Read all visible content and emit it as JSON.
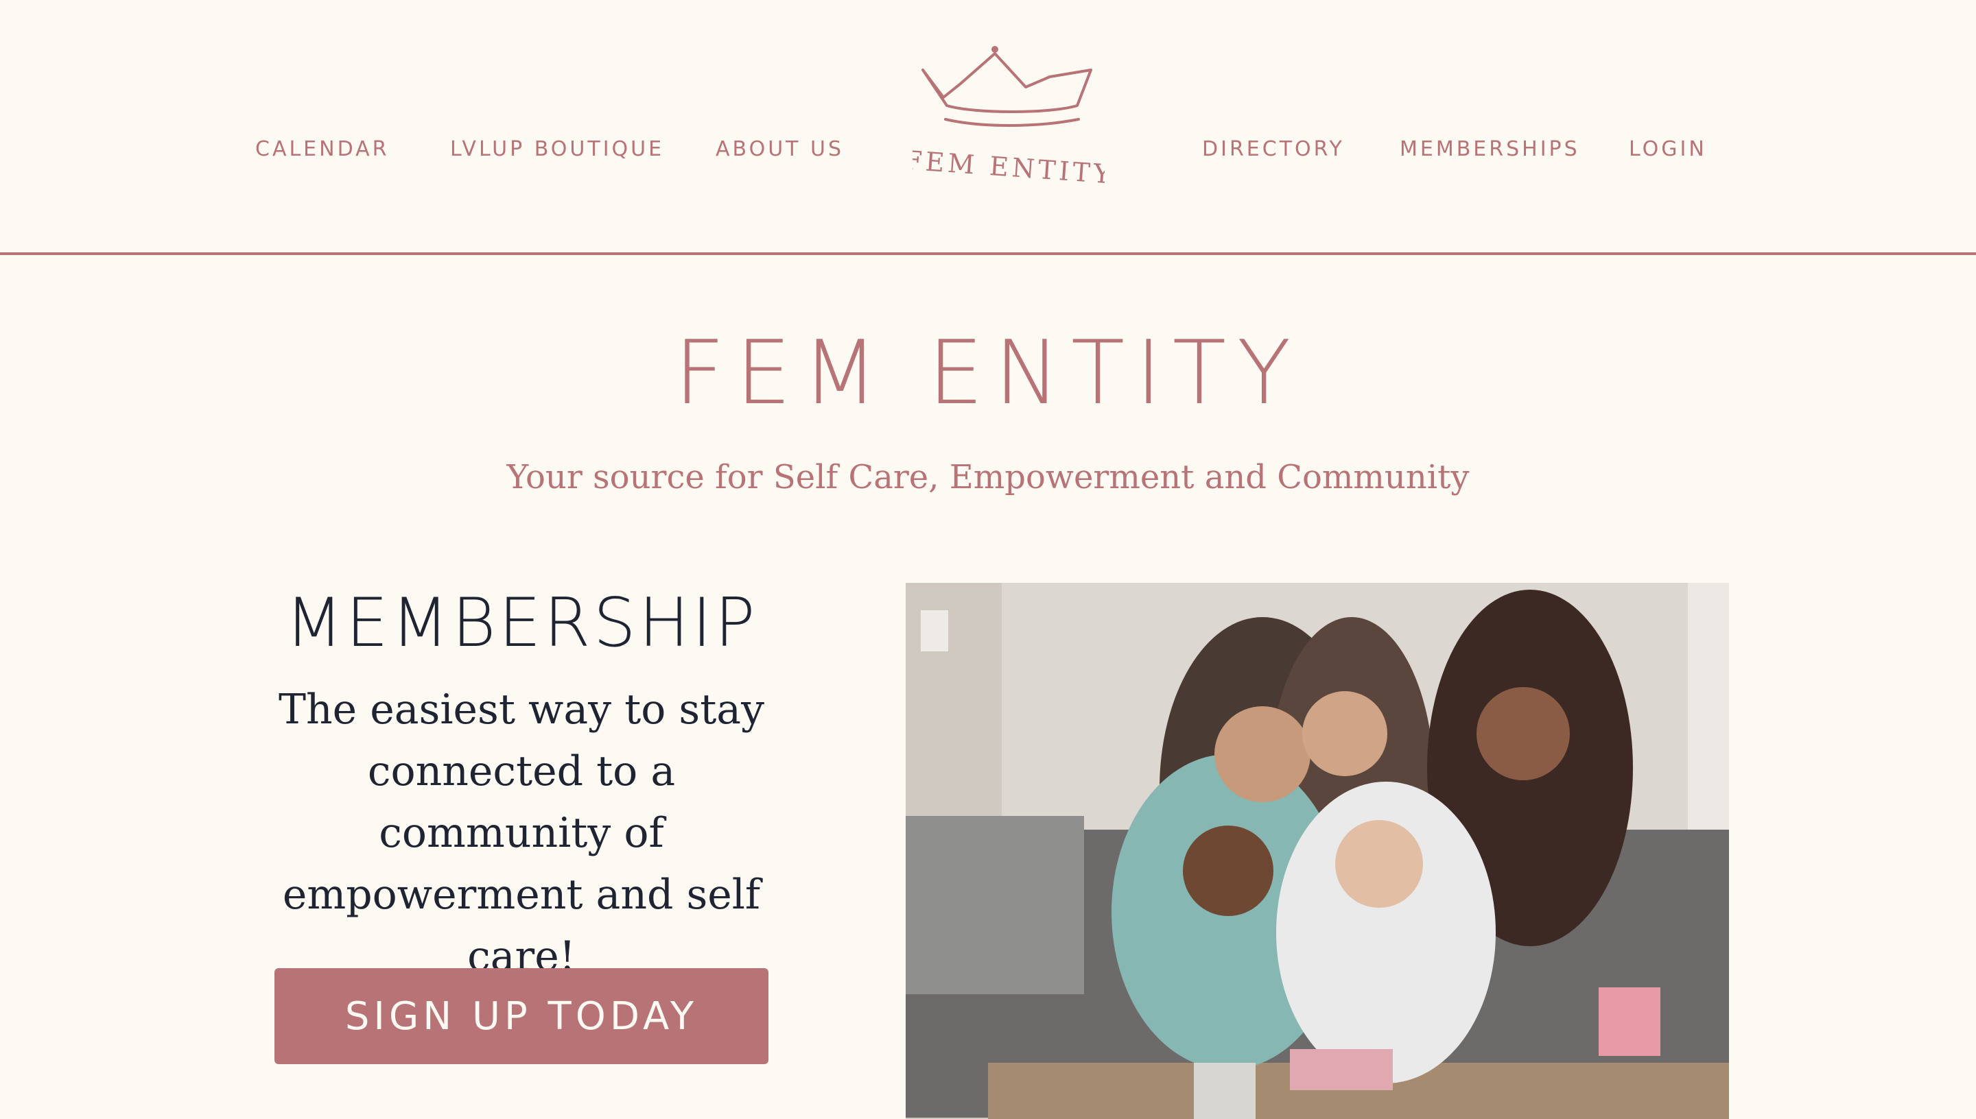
{
  "nav": {
    "left": [
      {
        "label": "CALENDAR"
      },
      {
        "label": "LVLUP BOUTIQUE"
      },
      {
        "label": "ABOUT US"
      }
    ],
    "right": [
      {
        "label": "DIRECTORY"
      },
      {
        "label": "MEMBERSHIPS"
      },
      {
        "label": "LOGIN"
      }
    ],
    "logo_text": "FEM ENTITY"
  },
  "hero": {
    "title": "FEM ENTITY",
    "tagline": "Your source for Self Care, Empowerment and Community"
  },
  "membership": {
    "heading": "MEMBERSHIP",
    "copy": "The easiest way to stay connected to a community of empowerment and self care!",
    "button_label": "SIGN UP TODAY"
  },
  "colors": {
    "accent": "#b87376",
    "background": "#fdf9f3",
    "text_dark": "#1f2433"
  },
  "icons": {
    "logo": "crown-icon"
  }
}
